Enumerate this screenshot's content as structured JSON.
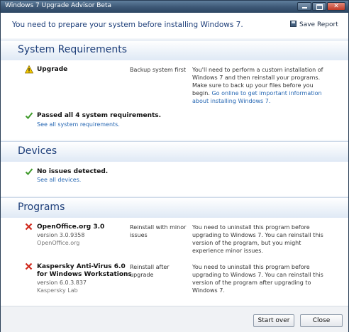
{
  "window": {
    "title": "Windows 7 Upgrade Advisor Beta"
  },
  "header": {
    "message": "You need to prepare your system before installing Windows 7.",
    "save_report": "Save Report"
  },
  "sections": {
    "system_requirements": {
      "title": "System Requirements",
      "upgrade": {
        "title": "Upgrade",
        "action": "Backup system first",
        "description": "You'll need to perform a custom installation of Windows 7 and then reinstall your programs. Make sure to back up your files before you begin.",
        "link": "Go online to get important information about installing Windows 7."
      },
      "passed": {
        "title": "Passed all 4 system requirements.",
        "link": "See all system requirements."
      }
    },
    "devices": {
      "title": "Devices",
      "status": "No issues detected.",
      "link": "See all devices."
    },
    "programs": {
      "title": "Programs",
      "items": [
        {
          "name": "OpenOffice.org 3.0",
          "version": "version 3.0.9358",
          "publisher": "OpenOffice.org",
          "action": "Reinstall with minor issues",
          "description": "You need to uninstall this program before upgrading to Windows 7. You can reinstall this version of the program, but you might experience minor issues."
        },
        {
          "name_line1": "Kaspersky Anti-Virus 6.0",
          "name_line2": "for Windows Workstations",
          "version": "version 6.0.3.837",
          "publisher": "Kaspersky Lab",
          "action": "Reinstall after upgrade",
          "description": "You need to uninstall this program before upgrading to Windows 7. You can reinstall this version of the program after upgrading to Windows 7."
        }
      ]
    }
  },
  "footer": {
    "start_over": "Start over",
    "close": "Close"
  },
  "colors": {
    "accent": "#1e3f7a",
    "link": "#2667b3",
    "success": "#3f9a2a",
    "error": "#d0281c",
    "warning": "#e5b800"
  },
  "icons": [
    "save-icon",
    "warning-icon",
    "check-icon",
    "error-x-icon",
    "minimize-icon",
    "maximize-icon",
    "close-icon"
  ]
}
